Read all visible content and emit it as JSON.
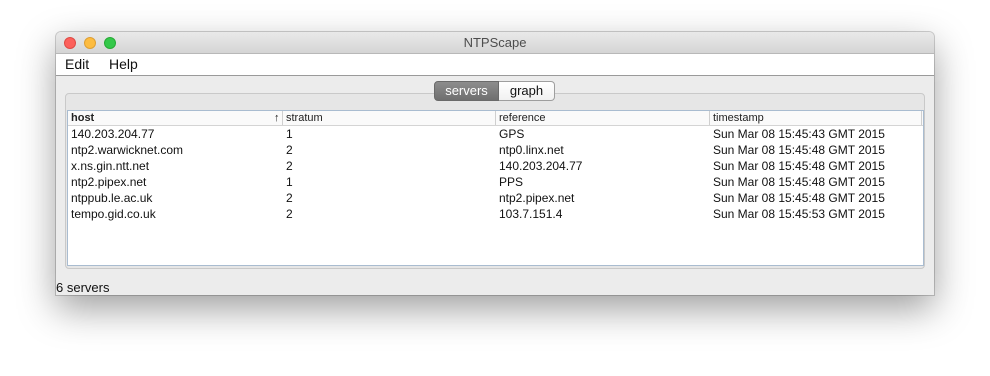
{
  "window": {
    "title": "NTPScape"
  },
  "menubar": {
    "items": [
      {
        "label": "Edit"
      },
      {
        "label": "Help"
      }
    ]
  },
  "tabs": [
    {
      "label": "servers",
      "selected": true
    },
    {
      "label": "graph",
      "selected": false
    }
  ],
  "table": {
    "columns": [
      {
        "label": "host",
        "sorted": "ascending"
      },
      {
        "label": "stratum"
      },
      {
        "label": "reference"
      },
      {
        "label": "timestamp"
      }
    ],
    "sort_icon": "up-arrow",
    "sort_glyph": "↑",
    "rows": [
      {
        "host": "140.203.204.77",
        "stratum": "1",
        "reference": "GPS",
        "timestamp": "Sun Mar 08 15:45:43 GMT 2015"
      },
      {
        "host": "ntp2.warwicknet.com",
        "stratum": "2",
        "reference": "ntp0.linx.net",
        "timestamp": "Sun Mar 08 15:45:48 GMT 2015"
      },
      {
        "host": "x.ns.gin.ntt.net",
        "stratum": "2",
        "reference": "140.203.204.77",
        "timestamp": "Sun Mar 08 15:45:48 GMT 2015"
      },
      {
        "host": "ntp2.pipex.net",
        "stratum": "1",
        "reference": "PPS",
        "timestamp": "Sun Mar 08 15:45:48 GMT 2015"
      },
      {
        "host": "ntppub.le.ac.uk",
        "stratum": "2",
        "reference": "ntp2.pipex.net",
        "timestamp": "Sun Mar 08 15:45:48 GMT 2015"
      },
      {
        "host": "tempo.gid.co.uk",
        "stratum": "2",
        "reference": "103.7.151.4",
        "timestamp": "Sun Mar 08 15:45:53 GMT 2015"
      }
    ]
  },
  "status": {
    "text": "6 servers"
  },
  "colors": {
    "close": "#fc605b",
    "minimize": "#fdbc40",
    "maximize": "#34c84a",
    "selected_tab": "#7d7d7d",
    "table_border": "#a9bcd0"
  }
}
